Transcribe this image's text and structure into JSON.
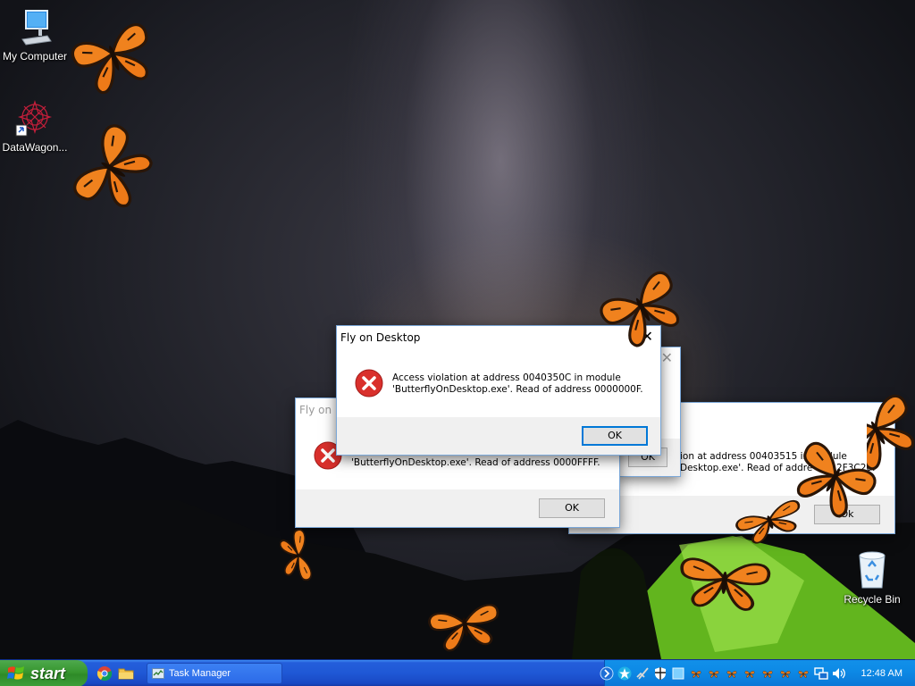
{
  "desktop": {
    "icons": [
      {
        "label": "My Computer",
        "icon": "computer-icon"
      },
      {
        "label": "DataWagon...",
        "icon": "datawagon-shortcut-icon"
      },
      {
        "label": "Recycle Bin",
        "icon": "recycle-bin-icon"
      }
    ],
    "overlay_app": "Fly on Desktop butterflies"
  },
  "dialogs": [
    {
      "title": "Fly on Desktop",
      "message_line1": "Access violation at address 0040350C in module",
      "message_line2": "'ButterflyOnDesktop.exe'. Read of address 0000000F.",
      "ok_label": "OK",
      "close_label": "✕",
      "state": "active"
    },
    {
      "title": "Fly on D",
      "message_line1": "",
      "message_line2": "'ButterflyOnDesktop.exe'. Read of address 0000FFFF.",
      "ok_label": "OK",
      "close_label": "",
      "state": "inactive"
    },
    {
      "title": "",
      "message_line1": "ion at address 00403515 in module",
      "message_line2": "Desktop.exe'. Read of addre        2F3C20.",
      "ok_label": "Ok",
      "close_label": "✕",
      "state": "inactive"
    },
    {
      "title": "",
      "message_line1": "",
      "message_line2": "",
      "ok_label": "Ok",
      "close_label": "",
      "state": "inactive"
    }
  ],
  "taskbar": {
    "start_label": "start",
    "quick_launch": [
      "chrome-icon",
      "folder-icon"
    ],
    "task_buttons": [
      {
        "label": "Task Manager",
        "icon": "task-manager-icon"
      }
    ],
    "tray_icons": [
      "expand-arrow-icon",
      "star-icon",
      "network-muted-icon",
      "shield-icon",
      "blue-square-icon",
      "butterfly-tray-icon",
      "network-icon",
      "volume-icon"
    ],
    "clock": "12:48 AM"
  },
  "colors": {
    "taskbar_blue": "#245edb",
    "start_green": "#37962f",
    "tray_blue": "#0d8ae6",
    "error_red": "#d9302c",
    "butterfly_orange": "#f0821e",
    "tent_green": "#7ccf2c"
  }
}
